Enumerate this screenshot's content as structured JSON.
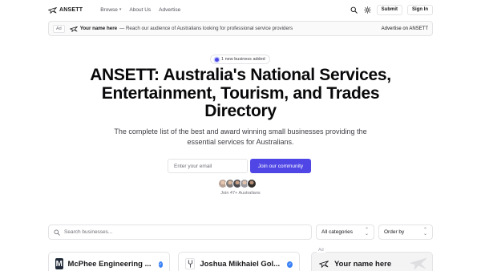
{
  "header": {
    "brand": "ANSETT",
    "nav": [
      {
        "label": "Browse",
        "has_dropdown": true
      },
      {
        "label": "About Us",
        "has_dropdown": false
      },
      {
        "label": "Advertise",
        "has_dropdown": false
      }
    ],
    "search_icon": "search-icon",
    "theme_icon": "sun-icon",
    "submit_label": "Submit",
    "signin_label": "Sign In"
  },
  "ad_banner": {
    "tag": "Ad",
    "name": "Your name here",
    "text": "— Reach our audience of Australians looking for professional service providers",
    "cta": "Advertise on ANSETT"
  },
  "hero": {
    "pill": "1 new business added",
    "title": "ANSETT: Australia's National Services, Entertainment, Tourism, and Trades Directory",
    "subtitle": "The complete list of the best and award winning small businesses providing the essential services for Australians.",
    "email_placeholder": "Enter your email",
    "join_label": "Join our community",
    "joined_text": "Join 47+ Australians"
  },
  "filters": {
    "search_placeholder": "Search businesses...",
    "category": "All categories",
    "order": "Order by"
  },
  "cards": [
    {
      "title": "McPhee Engineering ...",
      "logo_letter": "M",
      "verified": true
    },
    {
      "title": "Joshua Mikhaiel Gol...",
      "logo_icon": "tuning-fork-icon",
      "verified": true
    },
    {
      "title": "Your name here",
      "tag": "Ad",
      "logo_icon": "plane-icon"
    }
  ],
  "colors": {
    "accent": "#4f46e5",
    "verified": "#3b82f6",
    "border": "#e4e4e7"
  }
}
